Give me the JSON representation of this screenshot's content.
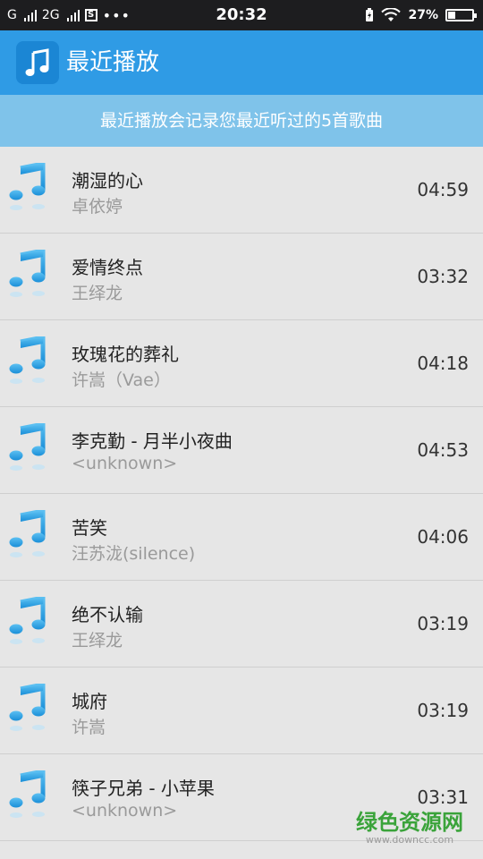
{
  "status_bar": {
    "carrier1": "G",
    "carrier2": "2G",
    "sim_icon": "S",
    "dots": "•••",
    "time": "20:32",
    "battery_percent": "27%"
  },
  "app_bar": {
    "title": "最近播放",
    "icon": "music-note-icon"
  },
  "notice": "最近播放会记录您最近听过的5首歌曲",
  "songs": [
    {
      "title": "潮湿的心",
      "artist": "卓依婷",
      "duration": "04:59"
    },
    {
      "title": "爱情终点",
      "artist": "王绎龙",
      "duration": "03:32"
    },
    {
      "title": "玫瑰花的葬礼",
      "artist": "许嵩（Vae）",
      "duration": "04:18"
    },
    {
      "title": "李克勤 - 月半小夜曲",
      "artist": "<unknown>",
      "duration": "04:53"
    },
    {
      "title": "苦笑",
      "artist": "汪苏泷(silence)",
      "duration": "04:06"
    },
    {
      "title": "绝不认输",
      "artist": "王绎龙",
      "duration": "03:19"
    },
    {
      "title": "城府",
      "artist": "许嵩",
      "duration": "03:19"
    },
    {
      "title": "筷子兄弟 - 小苹果",
      "artist": "<unknown>",
      "duration": "03:31"
    }
  ],
  "watermark": {
    "text": "绿色资源网",
    "url": "www.downcc.com"
  },
  "colors": {
    "app_bar": "#2f9be5",
    "notice_bg": "#7fc3ea",
    "list_bg": "#e6e6e6",
    "note_icon": "#2aa3e6"
  }
}
